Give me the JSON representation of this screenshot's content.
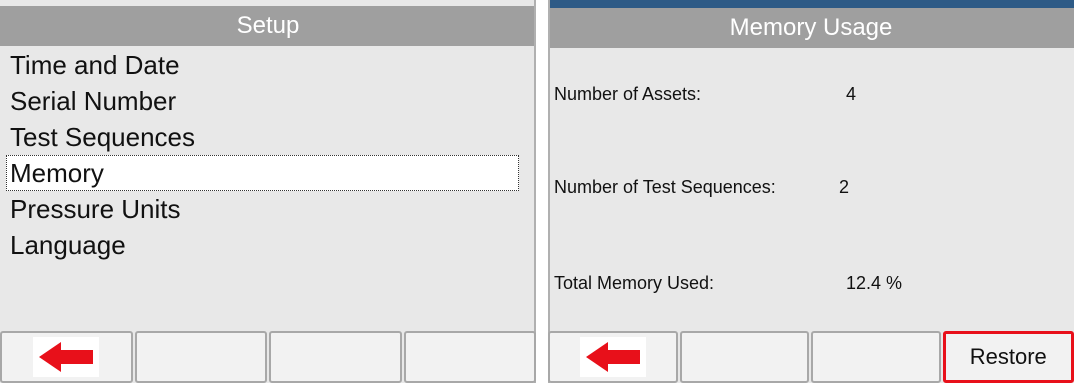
{
  "setup": {
    "title": "Setup",
    "items": [
      {
        "label": "Time and Date"
      },
      {
        "label": "Serial Number"
      },
      {
        "label": "Test Sequences"
      },
      {
        "label": "Memory",
        "selected": true
      },
      {
        "label": "Pressure Units"
      },
      {
        "label": "Language"
      }
    ],
    "softkeys": [
      {
        "icon": "back-arrow-icon",
        "label": ""
      },
      {
        "label": ""
      },
      {
        "label": ""
      },
      {
        "label": ""
      }
    ]
  },
  "memory_usage": {
    "title": "Memory Usage",
    "rows": [
      {
        "label": "Number of Assets:",
        "value": "4"
      },
      {
        "label": "Number of Test Sequences:",
        "value": "2"
      },
      {
        "label": "Total Memory Used:",
        "value": "12.4 %"
      }
    ],
    "softkeys": [
      {
        "icon": "back-arrow-icon",
        "label": ""
      },
      {
        "label": ""
      },
      {
        "label": ""
      },
      {
        "label": "Restore",
        "highlighted": true
      }
    ]
  },
  "colors": {
    "title_bar": "#9f9f9f",
    "background": "#e8e8e8",
    "arrow": "#e8101a",
    "highlight_border": "#e8101a"
  }
}
